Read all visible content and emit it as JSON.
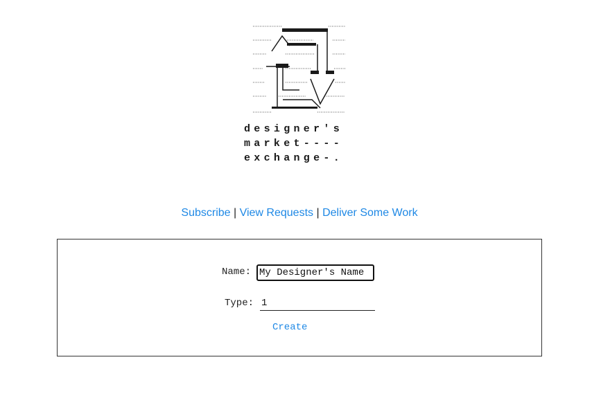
{
  "brand": {
    "line1": "designer's",
    "line2": "market----",
    "line3": "exchange-."
  },
  "nav": {
    "subscribe": "Subscribe",
    "sep1": " | ",
    "view_requests": "View Requests",
    "sep2": " | ",
    "deliver_work": "Deliver Some Work"
  },
  "form": {
    "name_label": "Name:",
    "name_value": "My Designer's Name",
    "type_label": "Type:",
    "type_value": "1",
    "create_label": "Create"
  },
  "colors": {
    "link": "#1e88e5",
    "text": "#222222",
    "border": "#333333"
  },
  "icons": {
    "logo": "exchange-arrows-ascii-logo"
  }
}
